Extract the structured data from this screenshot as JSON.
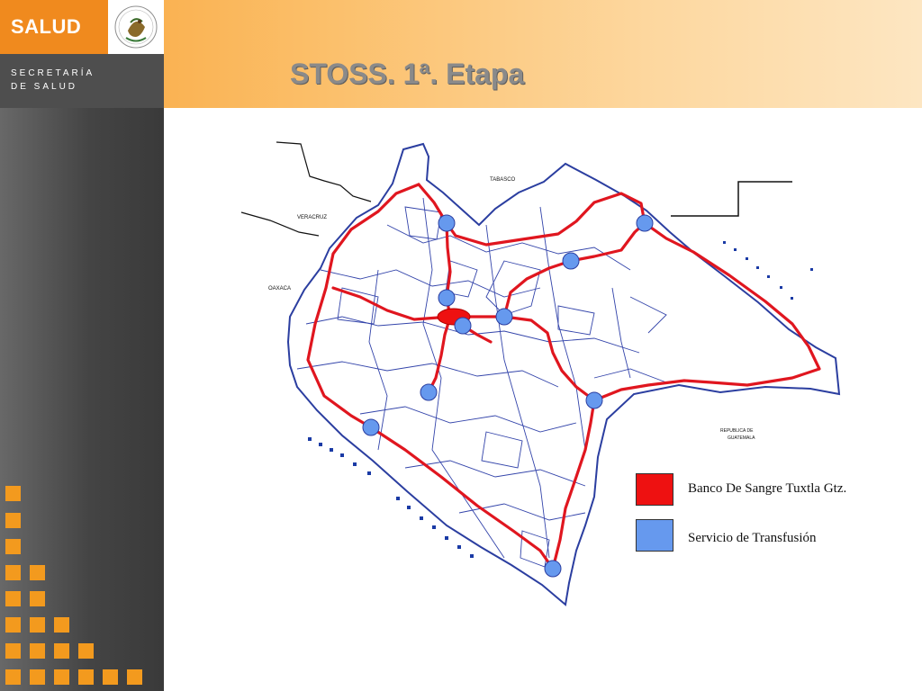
{
  "header": {
    "logo_text": "SALUD",
    "secretaria_line1": "SECRETARÍA",
    "secretaria_line2": "DE SALUD",
    "seal_icon": "mexican-coat-of-arms-seal",
    "seal_text": "ESTADOS UNIDOS MEXICANOS"
  },
  "slide": {
    "title": "STOSS. 1ª. Etapa"
  },
  "map": {
    "labels": {
      "tabasco": "TABASCO",
      "veracruz": "VERACRUZ",
      "oaxaca": "OAXACA",
      "guatemala_1": "REPUBLICA DE",
      "guatemala_2": "GUATEMALA"
    }
  },
  "legend": {
    "bank": {
      "label": "Banco De Sangre Tuxtla Gtz.",
      "color": "#ee1111"
    },
    "transfusion": {
      "label": "Servicio de Transfusión",
      "color": "#6699ee"
    }
  },
  "colors": {
    "accent_orange": "#f39a1e",
    "route_red": "#e0161f",
    "border_blue": "#3344aa",
    "node_blue": "#6699ee"
  }
}
